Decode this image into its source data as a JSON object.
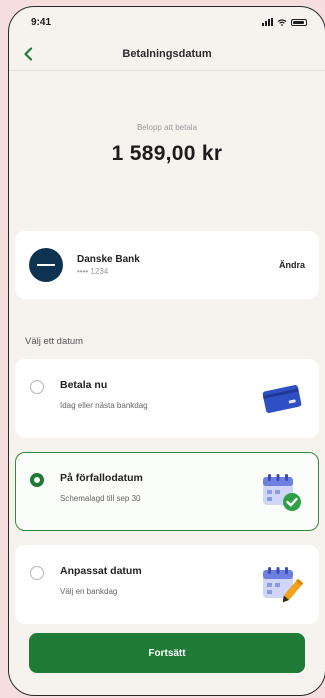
{
  "status_bar": {
    "time": "9:41"
  },
  "nav": {
    "title": "Betalningsdatum"
  },
  "amount": {
    "label": "Belopp att betala",
    "value": "1 589,00 kr"
  },
  "bank": {
    "name": "Danske Bank",
    "account": "•••• 1234",
    "change_label": "Ändra"
  },
  "section_title": "Välj ett datum",
  "options": [
    {
      "title": "Betala nu",
      "subtitle": "Idag eller nästa bankdag",
      "selected": false,
      "icon": "credit-card-icon"
    },
    {
      "title": "På förfallodatum",
      "subtitle": "Schemalagd till sep 30",
      "selected": true,
      "icon": "calendar-check-icon"
    },
    {
      "title": "Anpassat datum",
      "subtitle": "Välj en bankdag",
      "selected": false,
      "icon": "calendar-edit-icon"
    }
  ],
  "cta_label": "Fortsätt",
  "colors": {
    "accent": "#1f7a35",
    "bank_logo": "#0e3252",
    "card_icon": "#2f4fc4",
    "calendar_icon": "#6f7fe0",
    "pencil": "#f2a21b"
  }
}
